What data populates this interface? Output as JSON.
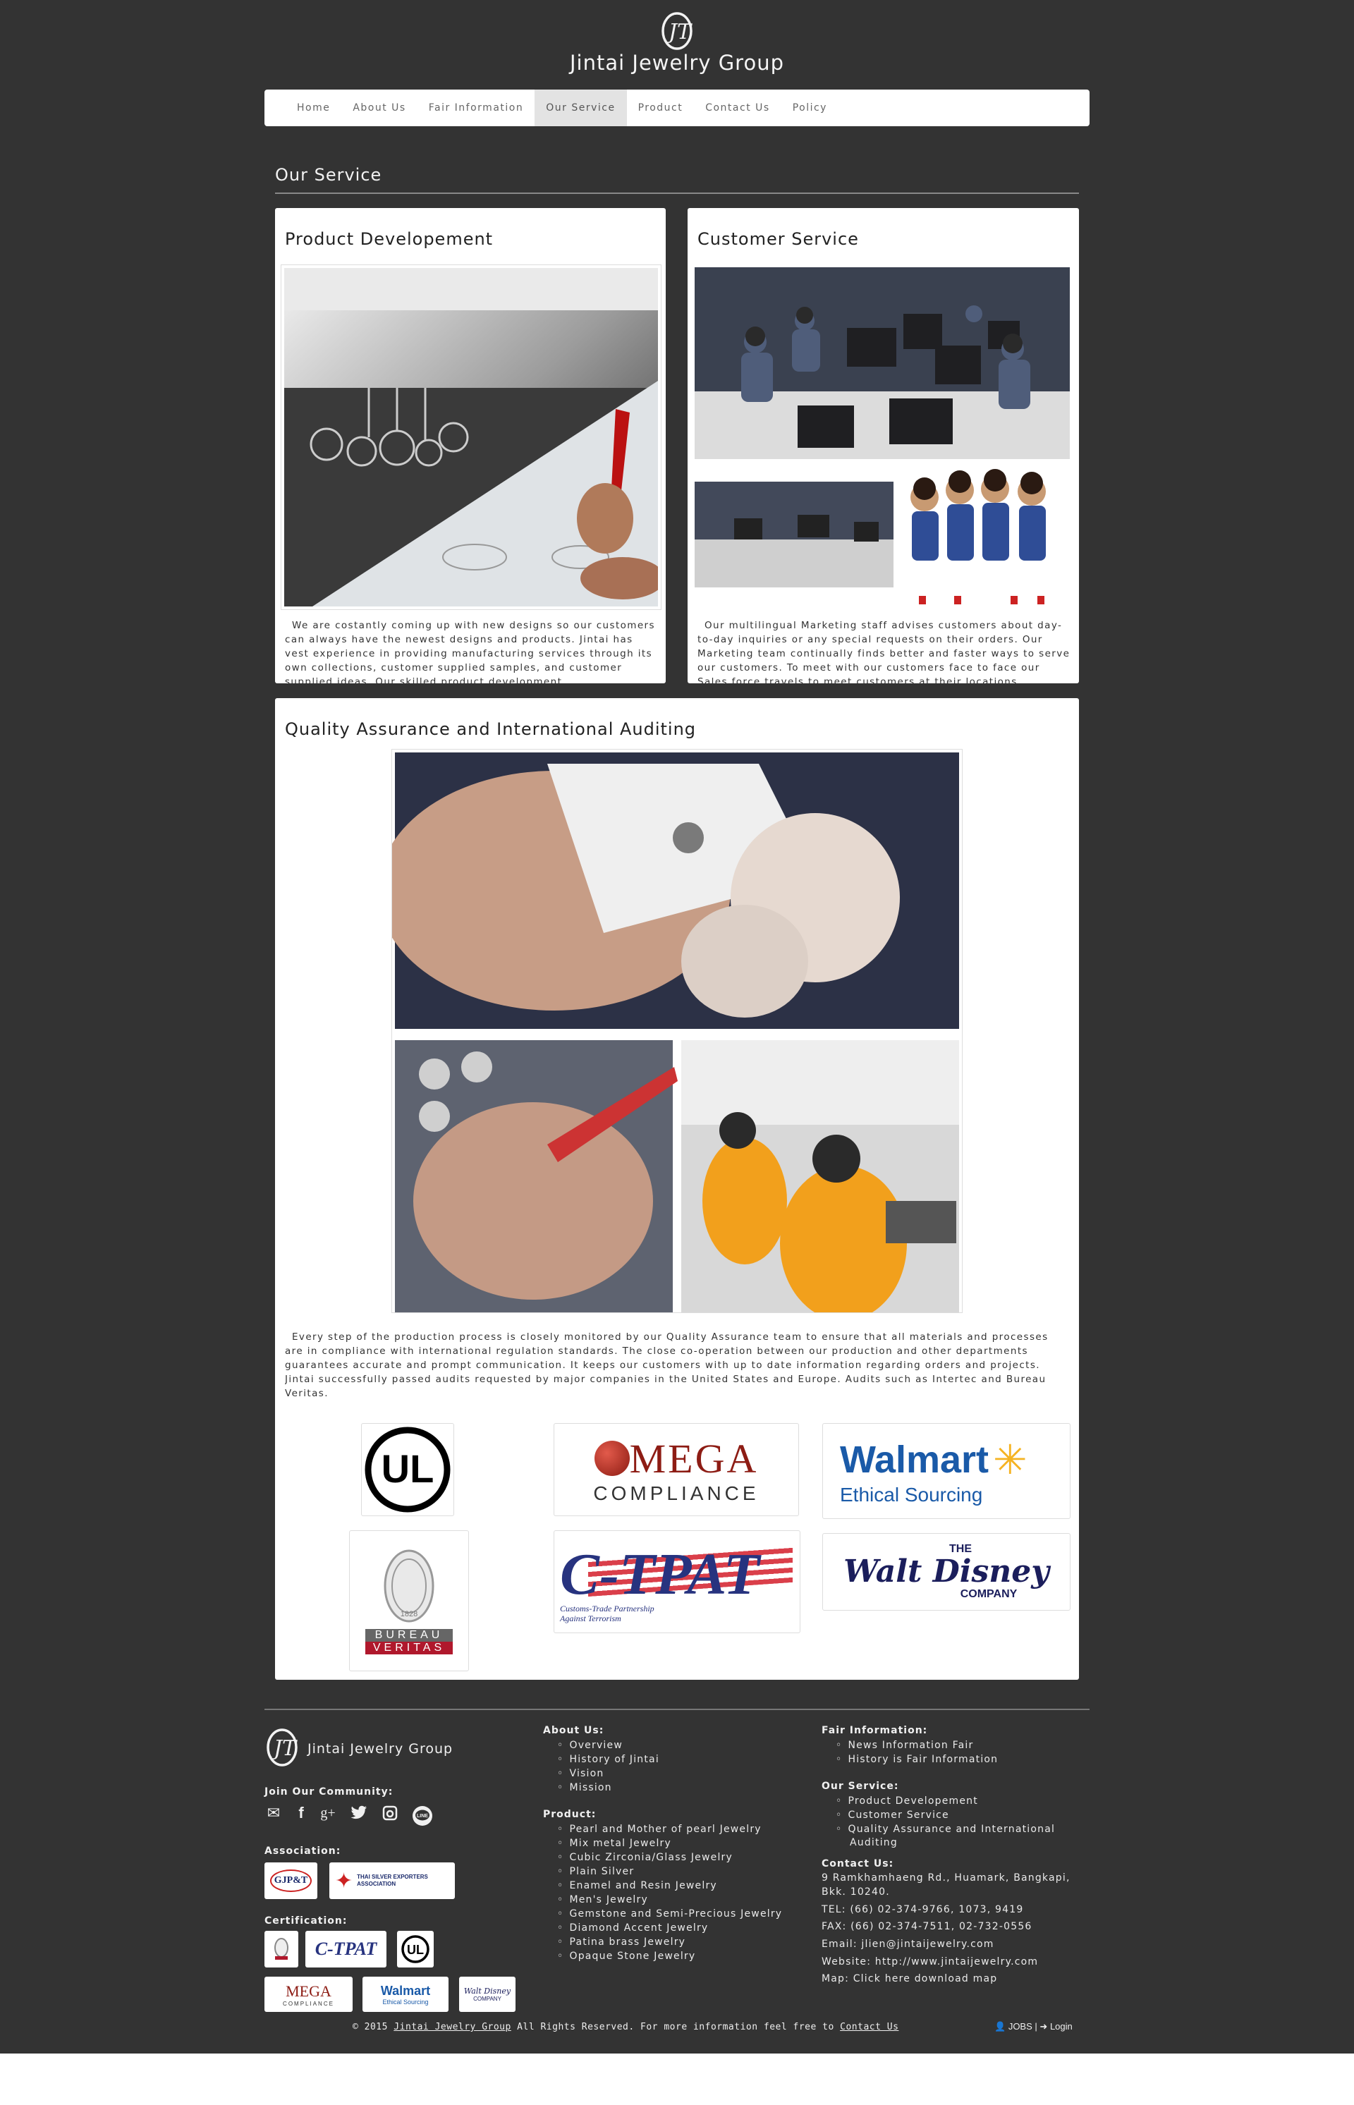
{
  "brand": {
    "name": "Jintai Jewelry Group"
  },
  "nav": {
    "items": [
      "Home",
      "About Us",
      "Fair Information",
      "Our Service",
      "Product",
      "Contact Us",
      "Policy"
    ],
    "active": "Our Service"
  },
  "page": {
    "title": "Our Service"
  },
  "cards": {
    "product": {
      "title": "Product Developement",
      "text": "We are costantly coming up with new designs so our customers can always have the newest designs and products. Jintai has vest experience in providing manufacturing services through its own collections, customer supplied samples, and customer supplied ideas. Our skilled product development"
    },
    "customer": {
      "title": "Customer Service",
      "text": "Our multilingual Marketing staff advises customers about day-to-day inquiries or any special requests on their orders. Our Marketing team continually finds better and faster ways to serve our customers. To meet with our customers face to face our Sales force travels to meet customers at their locations"
    },
    "quality": {
      "title": "Quality Assurance and International Auditing",
      "text": "Every step of the production process is closely monitored by our Quality Assurance team to ensure that all materials and processes are in compliance with international regulation standards. The close co-operation between our production and other departments guarantees accurate and prompt communication. It keeps our customers with up to date information regarding orders and projects. Jintai successfully passed audits requested by major companies in the United States and Europe. Audits such as Intertec and Bureau Veritas."
    }
  },
  "certs": {
    "ul": "UL",
    "mega": "MEGA",
    "mega_sub": "COMPLIANCE",
    "walmart": "Walmart",
    "walmart_sub": "Ethical Sourcing",
    "bv_top": "BUREAU",
    "bv_bottom": "VERITAS",
    "bv_year": "1828",
    "ctpat": "C-TPAT",
    "ctpat_sub": "Customs-Trade Partnership Against Terrorism",
    "disney_the": "THE",
    "disney": "Walt Disney",
    "disney_sub": "COMPANY"
  },
  "footer": {
    "brand": "Jintai Jewelry Group",
    "community": "Join Our Community:",
    "association": "Association:",
    "certification": "Certification:",
    "assoc_gjp": "GJP&T",
    "assoc_thai": "THAI SILVER EXPORTERS ASSOCIATION",
    "about_head": "About Us:",
    "about_items": [
      "Overview",
      "History of Jintai",
      "Vision",
      "Mission"
    ],
    "product_head": "Product:",
    "product_items": [
      "Pearl and Mother of pearl Jewelry",
      "Mix metal Jewelry",
      "Cubic Zirconia/Glass Jewelry",
      "Plain Silver",
      "Enamel and Resin Jewelry",
      "Men's Jewelry",
      "Gemstone and Semi-Precious Jewelry",
      "Diamond Accent Jewelry",
      "Patina brass Jewelry",
      "Opaque Stone Jewelry"
    ],
    "fair_head": "Fair Information:",
    "fair_items": [
      "News Information Fair",
      "History is Fair Information"
    ],
    "service_head": "Our Service:",
    "service_items": [
      "Product Developement",
      "Customer Service",
      "Quality Assurance and International",
      "Auditing"
    ],
    "contact_head": "Contact Us:",
    "address1": "9 Ramkhamhaeng Rd., Huamark, Bangkapi,",
    "address2": "Bkk. 10240.",
    "tel": "TEL: (66) 02-374-9766, 1073, 9419",
    "fax": "FAX: (66) 02-374-7511, 02-732-0556",
    "email": "Email: jlien@jintaijewelry.com",
    "website": "Website: http://www.jintaijewelry.com",
    "map": "Map: Click here download map",
    "copy_pre": "© 2015",
    "copy_link": "Jintai Jewelry Group",
    "copy_mid": "All Rights Reserved. For more information feel free to",
    "copy_contact": "Contact Us",
    "jobs": "JOBS",
    "login": "Login"
  },
  "icons": [
    "logo-icon",
    "mail-icon",
    "facebook-icon",
    "google-plus-icon",
    "twitter-icon",
    "instagram-icon",
    "line-icon",
    "user-icon",
    "login-icon"
  ]
}
